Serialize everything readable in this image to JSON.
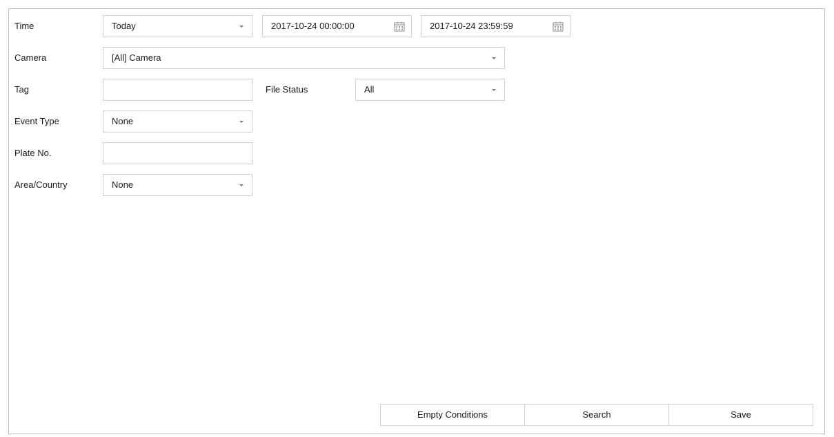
{
  "form": {
    "time": {
      "label": "Time",
      "range": "Today",
      "start": "2017-10-24 00:00:00",
      "end": "2017-10-24 23:59:59"
    },
    "camera": {
      "label": "Camera",
      "value": "[All] Camera"
    },
    "tag": {
      "label": "Tag",
      "value": ""
    },
    "file_status": {
      "label": "File Status",
      "value": "All"
    },
    "event_type": {
      "label": "Event Type",
      "value": "None"
    },
    "plate_no": {
      "label": "Plate No.",
      "value": ""
    },
    "area_country": {
      "label": "Area/Country",
      "value": "None"
    }
  },
  "actions": {
    "empty_conditions": "Empty Conditions",
    "search": "Search",
    "save": "Save"
  },
  "icons": {
    "dropdown": "chevron-down-icon",
    "calendar": "calendar-icon"
  },
  "colors": {
    "border": "#cfcfcf",
    "panel_border": "#bdbdbd",
    "text": "#1a1a1a"
  }
}
